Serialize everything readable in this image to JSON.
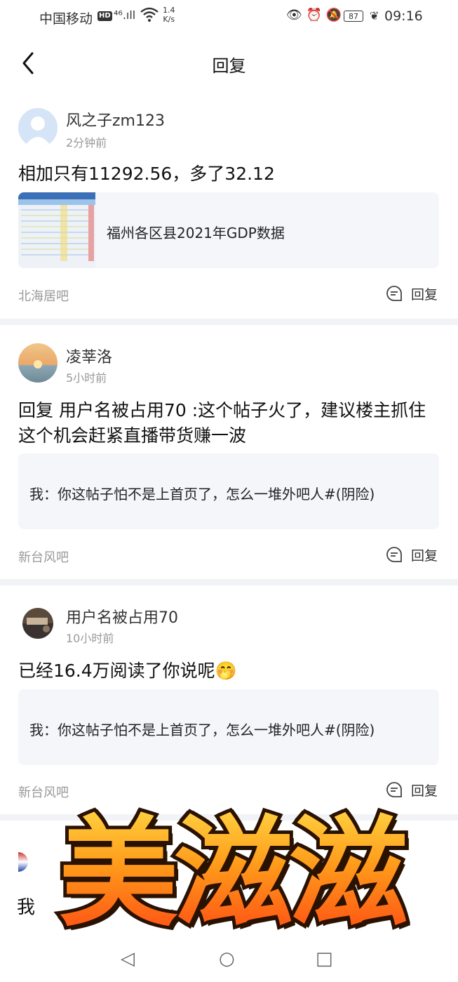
{
  "status_bar": {
    "carrier": "中国移动",
    "hd": "HD",
    "signal": "⁴⁶.ıll",
    "speed_value": "1.4",
    "speed_unit": "K/s",
    "icons_right": "👁 ⏰ 🔕",
    "battery": "87",
    "time": "09:16"
  },
  "header": {
    "title": "回复"
  },
  "posts": [
    {
      "username": "风之子zm123",
      "time": "2分钟前",
      "text": "相加只有11292.56，多了32.12",
      "quote": "福州各区县2021年GDP数据",
      "forum": "北海居吧",
      "reply_label": "回复"
    },
    {
      "username": "凌莘洛",
      "time": "5小时前",
      "text": "回复 用户名被占用70 :这个帖子火了，建议楼主抓住这个机会赶紧直播带货赚一波",
      "quote": "我：你这帖子怕不是上首页了，怎么一堆外吧人#(阴险)",
      "forum": "新台风吧",
      "reply_label": "回复"
    },
    {
      "username": "用户名被占用70",
      "time": "10小时前",
      "text": "已经16.4万阅读了你说呢🤭",
      "quote": "我：你这帖子怕不是上首页了，怎么一堆外吧人#(阴险)",
      "forum": "新台风吧",
      "reply_label": "回复"
    }
  ],
  "sticker": {
    "text": "美滋滋"
  },
  "partial_post": {
    "first_char": "我"
  }
}
